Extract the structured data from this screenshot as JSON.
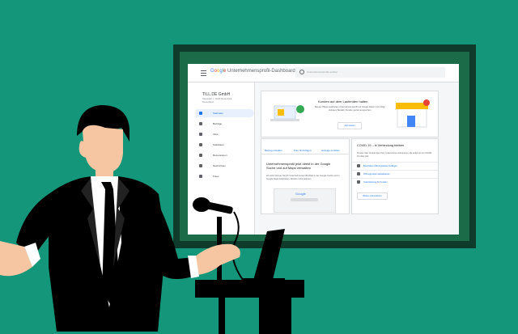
{
  "dashboard": {
    "logo_google": "Google",
    "logo_rest": " Unternehmensprofil-Dashboard",
    "search_placeholder": "Unternehmensprofile suchen",
    "business_name": "TILL.DE GmbH",
    "business_address": "Hauptplatz 1, 12345 Musterstadt, Deutschland",
    "nav": [
      {
        "label": "Startseite",
        "icon": "home-icon",
        "active": true
      },
      {
        "label": "Beiträge",
        "icon": "posts-icon",
        "active": false
      },
      {
        "label": "Infos",
        "icon": "info-icon",
        "active": false
      },
      {
        "label": "Statistiken",
        "icon": "stats-icon",
        "active": false
      },
      {
        "label": "Rezensionen",
        "icon": "reviews-icon",
        "active": false
      },
      {
        "label": "Nachrichten",
        "icon": "messages-icon",
        "active": false
      },
      {
        "label": "Fotos",
        "icon": "photos-icon",
        "active": false
      }
    ],
    "hero_card": {
      "title": "Kunden auf dem Laufenden halten",
      "description": "Bei der Pflege bearbeiten Unternehmensprofil auf Google Daten und erfolgt Zeitraum Bestellt. Kunden gezielt ansprechen.",
      "button": "Jetzt starten"
    },
    "tabs_card": {
      "tabs": [
        "Beitrag erstellen",
        "Foto hinzufügen",
        "Anzeige erstellen"
      ],
      "heading": "Unternehmensprofil jetzt direkt in der Google Suche und auf Maps verwalten",
      "text": "Ab sofort können Sie Ihr Unternehmensprofil direkt in der Google Suche und in Google Maps bearbeiten. Weitere Informationen",
      "mock_logo": "Google"
    },
    "covid_card": {
      "title": "COVID-19 – in Verbindung bleiben",
      "text": "Kunden über Änderungen Ihrer Unternehmen informieren, die aufgrund von COVID-19 nötig sind",
      "rows": [
        "Besondere Öffnungszeiten festlegen",
        "Öffnungszeiten aktualisieren",
        "Unterstützung für Kunden"
      ],
      "button": "Weitere Informationen"
    }
  }
}
